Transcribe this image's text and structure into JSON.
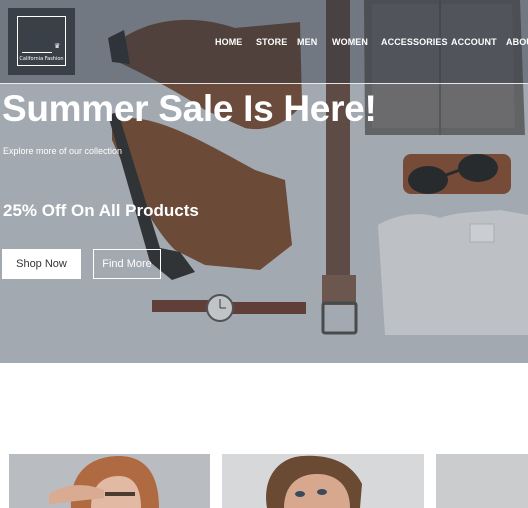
{
  "brand": {
    "logo_text": "California Fashion",
    "logo_icon": "crown-icon"
  },
  "nav": {
    "items": [
      "HOME",
      "STORE",
      "MEN",
      "WOMEN",
      "ACCESSORIES",
      "ACCOUNT",
      "ABOUT"
    ]
  },
  "hero": {
    "headline": "Summer Sale Is Here!",
    "subline": "Explore more of our collection",
    "offer": "25% Off On All Products",
    "primary_button": "Shop Now",
    "secondary_button": "Find More"
  },
  "colors": {
    "overlay": "#5a6472",
    "button_bg": "#ffffff",
    "text_light": "#ffffff"
  }
}
